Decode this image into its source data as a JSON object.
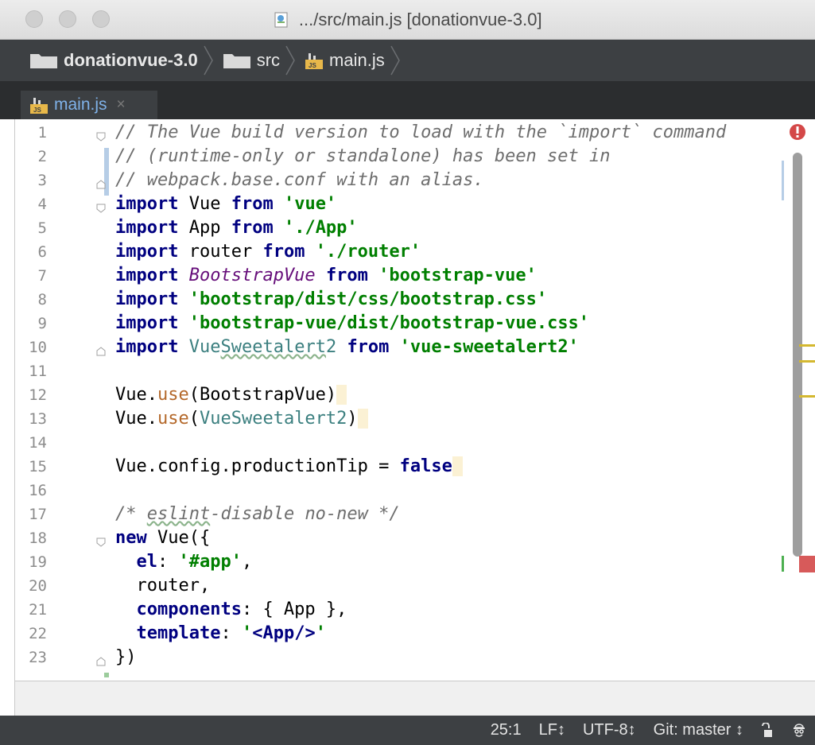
{
  "window": {
    "title": ".../src/main.js [donationvue-3.0]"
  },
  "breadcrumb": {
    "project": "donationvue-3.0",
    "folder": "src",
    "file": "main.js"
  },
  "tabs": [
    {
      "label": "main.js",
      "close_icon": "×"
    }
  ],
  "editor": {
    "line_numbers": [
      "1",
      "2",
      "3",
      "4",
      "5",
      "6",
      "7",
      "8",
      "9",
      "10",
      "11",
      "12",
      "13",
      "14",
      "15",
      "16",
      "17",
      "18",
      "19",
      "20",
      "21",
      "22",
      "23"
    ],
    "lines": [
      "// The Vue build version to load with the `import` command",
      "// (runtime-only or standalone) has been set in",
      "// webpack.base.conf with an alias.",
      "import Vue from 'vue'",
      "import App from './App'",
      "import router from './router'",
      "import BootstrapVue from 'bootstrap-vue'",
      "import 'bootstrap/dist/css/bootstrap.css'",
      "import 'bootstrap-vue/dist/bootstrap-vue.css'",
      "import VueSweetalert2 from 'vue-sweetalert2'",
      "",
      "Vue.use(BootstrapVue)",
      "Vue.use(VueSweetalert2)",
      "",
      "Vue.config.productionTip = false",
      "",
      "/* eslint-disable no-new */",
      "new Vue({",
      "  el: '#app',",
      "  router,",
      "  components: { App },",
      "  template: '<App/>'",
      "})"
    ],
    "colors": {
      "comment": "#6e6e6e",
      "keyword": "#000080",
      "string": "#007f00",
      "error_marker": "#d75a5a",
      "warning_marker": "#d4b830"
    }
  },
  "statusbar": {
    "position": "25:1",
    "line_separator": "LF↕",
    "encoding": "UTF-8↕",
    "vcs": "Git: master ↕"
  }
}
